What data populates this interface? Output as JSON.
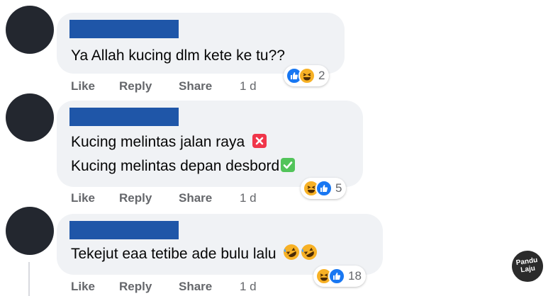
{
  "comments": [
    {
      "text_lines": [
        "Ya Allah kucing dlm kete ke tu??"
      ],
      "actions": {
        "like": "Like",
        "reply": "Reply",
        "share": "Share",
        "time": "1 d"
      },
      "reactions": {
        "icons": [
          "like-icon",
          "haha-icon"
        ],
        "count": "2"
      }
    },
    {
      "text_lines": [
        "Kucing melintas jalan raya",
        "Kucing melintas depan desbord"
      ],
      "inline_icons": [
        "cross-mark-icon",
        "check-mark-icon"
      ],
      "actions": {
        "like": "Like",
        "reply": "Reply",
        "share": "Share",
        "time": "1 d"
      },
      "reactions": {
        "icons": [
          "haha-icon",
          "like-icon"
        ],
        "count": "5"
      }
    },
    {
      "text_lines": [
        "Tekejut eaa tetibe ade bulu lalu"
      ],
      "inline_icons": [
        "rofl-icon",
        "rofl-icon"
      ],
      "actions": {
        "like": "Like",
        "reply": "Reply",
        "share": "Share",
        "time": "1 d"
      },
      "reactions": {
        "icons": [
          "haha-icon",
          "like-icon"
        ],
        "count": "18"
      }
    }
  ],
  "watermark": {
    "lines": [
      "Pandu",
      "Laju"
    ]
  },
  "colors": {
    "bubble": "#f0f2f5",
    "name_redaction": "#1f56a8",
    "like": "#1877f2",
    "haha": "#f7b125",
    "meta": "#65676b"
  }
}
